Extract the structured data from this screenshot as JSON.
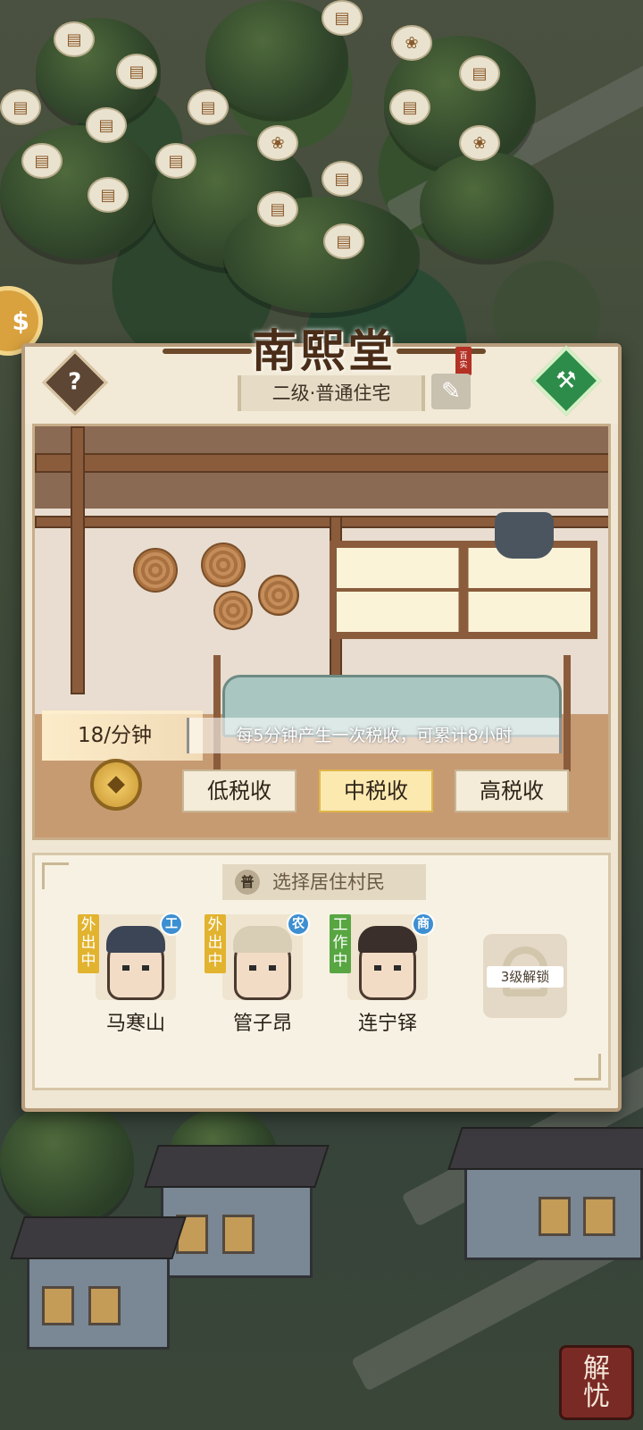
{
  "building": {
    "name": "南熙堂",
    "level_type": "二级·普通住宅"
  },
  "tax": {
    "rate": "18/分钟",
    "description": "每5分钟产生一次税收，可累计8小时",
    "options": [
      "低税收",
      "中税收",
      "高税收"
    ],
    "selected": "中税收"
  },
  "residents": {
    "section_title": "选择居住村民",
    "badge": "普",
    "list": [
      {
        "name": "马寒山",
        "status": "外出中",
        "job": "工"
      },
      {
        "name": "管子昂",
        "status": "外出中",
        "job": "农"
      },
      {
        "name": "连宁铎",
        "status": "工作中",
        "job": "商"
      }
    ],
    "locked_label": "3级解锁"
  },
  "side": {
    "button_label_1": "解",
    "button_label_2": "忧"
  },
  "icons": {
    "help": "question-icon",
    "upgrade": "hammer-icon",
    "edit": "brush-icon",
    "currency": "copper-coin-icon"
  },
  "colors": {
    "panel_bg": "#efe7d3",
    "accent_green": "#2e8c4a",
    "selected_tax": "#fbe9b0"
  }
}
